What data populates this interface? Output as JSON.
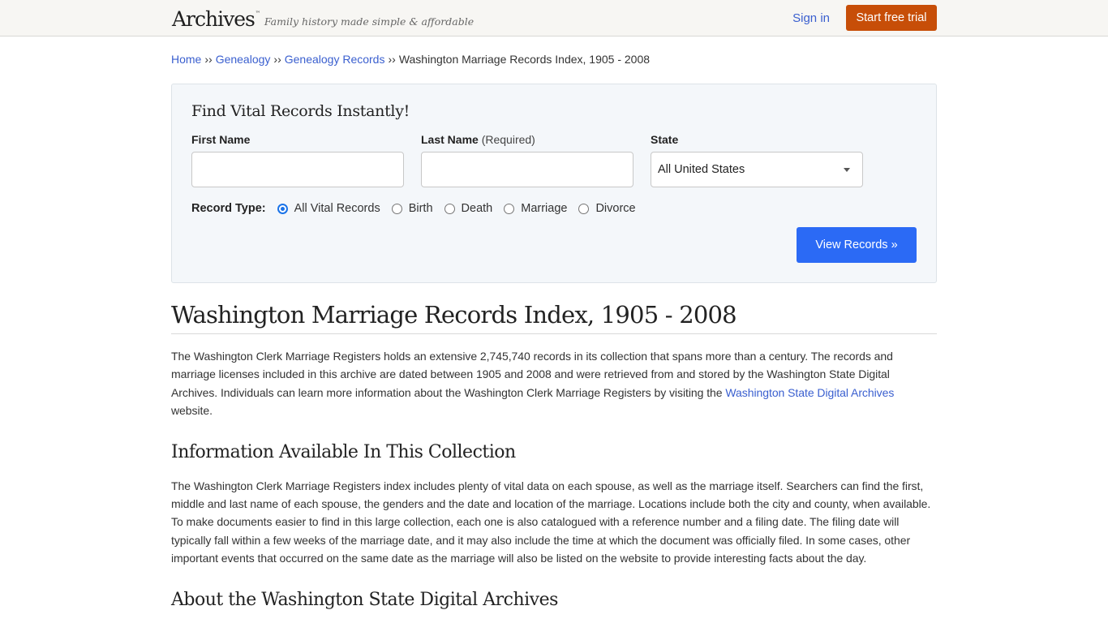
{
  "header": {
    "logo": "Archives",
    "logo_mark": "™",
    "tagline": "Family history made simple & affordable",
    "signin_label": "Sign in",
    "trial_label": "Start free trial"
  },
  "breadcrumb": {
    "items": [
      {
        "label": "Home"
      },
      {
        "label": "Genealogy"
      },
      {
        "label": "Genealogy Records"
      }
    ],
    "separator": "››",
    "current": "Washington Marriage Records Index, 1905 - 2008"
  },
  "search": {
    "title": "Find Vital Records Instantly!",
    "first_name_label": "First Name",
    "first_name_value": "",
    "last_name_label": "Last Name",
    "last_name_note": "(Required)",
    "last_name_value": "",
    "state_label": "State",
    "state_value": "All United States",
    "record_type_label": "Record Type:",
    "record_types": [
      {
        "label": "All Vital Records",
        "checked": true
      },
      {
        "label": "Birth",
        "checked": false
      },
      {
        "label": "Death",
        "checked": false
      },
      {
        "label": "Marriage",
        "checked": false
      },
      {
        "label": "Divorce",
        "checked": false
      }
    ],
    "submit_label": "View Records »"
  },
  "article": {
    "title": "Washington Marriage Records Index, 1905 - 2008",
    "intro_before_link": "The Washington Clerk Marriage Registers holds an extensive 2,745,740 records in its collection that spans more than a century. The records and marriage licenses included in this archive are dated between 1905 and 2008 and were retrieved from and stored by the Washington State Digital Archives. Individuals can learn more information about the Washington Clerk Marriage Registers by visiting the ",
    "intro_link": "Washington State Digital Archives",
    "intro_after_link": " website.",
    "section1_title": "Information Available In This Collection",
    "section1_text": "The Washington Clerk Marriage Registers index includes plenty of vital data on each spouse, as well as the marriage itself. Searchers can find the first, middle and last name of each spouse, the genders and the date and location of the marriage. Locations include both the city and county, when available. To make documents easier to find in this large collection, each one is also catalogued with a reference number and a filing date. The filing date will typically fall within a few weeks of the marriage date, and it may also include the time at which the document was officially filed. In some cases, other important events that occurred on the same date as the marriage will also be listed on the website to provide interesting facts about the day.",
    "section2_title": "About the Washington State Digital Archives"
  },
  "colors": {
    "accent_orange": "#c74e08",
    "primary_blue": "#2b6af5",
    "link_blue": "#3a5fcf"
  }
}
